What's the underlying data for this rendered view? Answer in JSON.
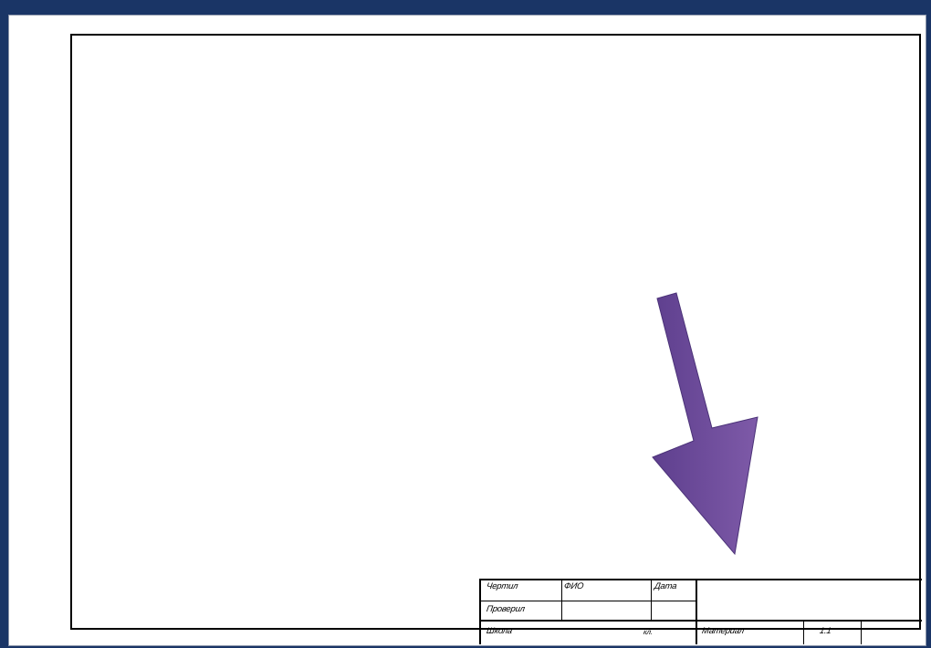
{
  "title_block": {
    "drawn_label": "Чертил",
    "name_label": "ФИО",
    "date_label": "Дата",
    "checked_label": "Проверил",
    "school_label": "Школа",
    "class_label": "кл.",
    "material_label": "Материал",
    "scale_value": "1:1"
  },
  "colors": {
    "background": "#1a3566",
    "arrow": "#6a4a9c"
  }
}
